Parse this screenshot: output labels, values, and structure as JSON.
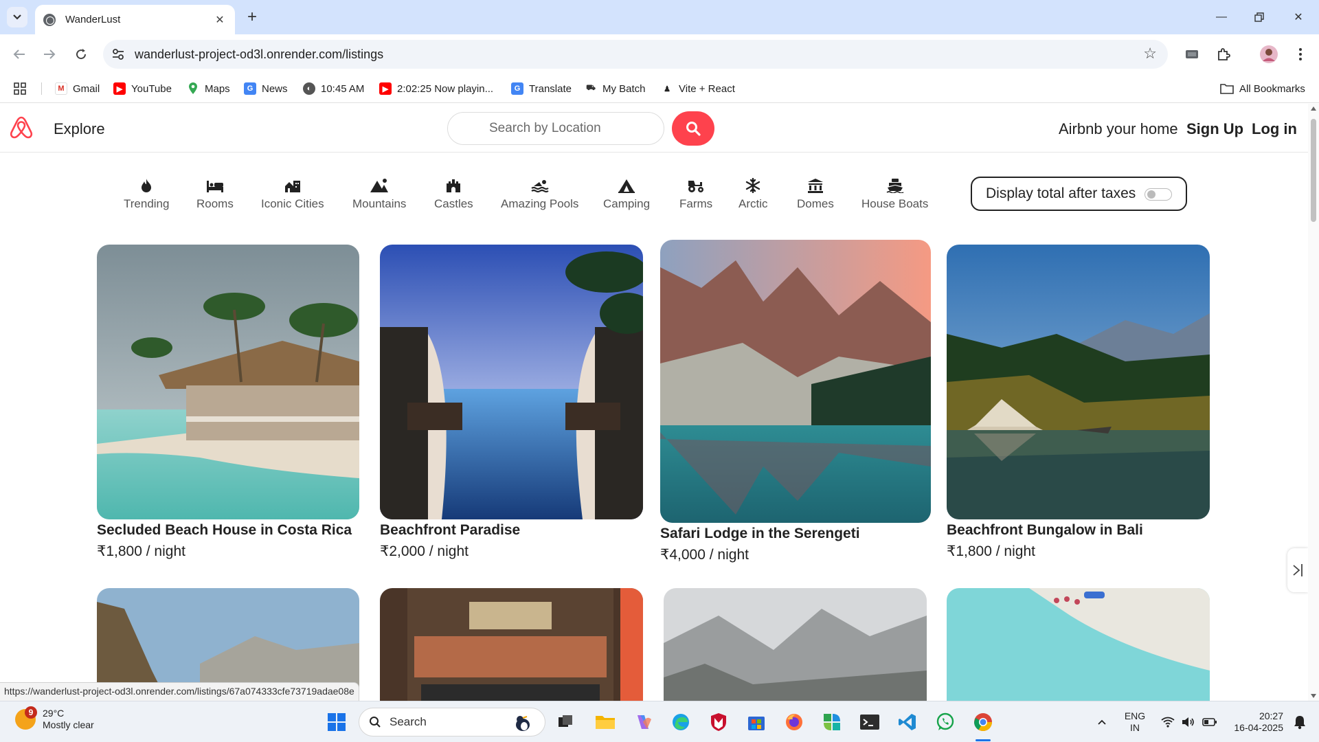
{
  "browser": {
    "tab_title": "WanderLust",
    "url": "wanderlust-project-od3l.onrender.com/listings",
    "status_url": "https://wanderlust-project-od3l.onrender.com/listings/67a074333cfe73719adae08e"
  },
  "bookmarks": {
    "items": [
      {
        "label": "Gmail",
        "icon": "gmail-icon"
      },
      {
        "label": "YouTube",
        "icon": "youtube-icon"
      },
      {
        "label": "Maps",
        "icon": "maps-icon"
      },
      {
        "label": "News",
        "icon": "news-icon"
      },
      {
        "label": "10:45 AM",
        "icon": "globe-icon"
      },
      {
        "label": "2:02:25 Now playin...",
        "icon": "youtube-icon"
      },
      {
        "label": "Translate",
        "icon": "translate-icon"
      },
      {
        "label": "My Batch",
        "icon": "batch-icon"
      },
      {
        "label": "Vite + React",
        "icon": "react-icon"
      }
    ],
    "all_bookmarks": "All Bookmarks"
  },
  "site": {
    "explore": "Explore",
    "search_placeholder": "Search by Location",
    "airbnb_home": "Airbnb your home",
    "sign_up": "Sign Up",
    "log_in": "Log in",
    "brand_color": "#fe424d"
  },
  "filters": [
    {
      "label": "Trending",
      "icon": "fire-icon"
    },
    {
      "label": "Rooms",
      "icon": "bed-icon"
    },
    {
      "label": "Iconic Cities",
      "icon": "city-icon"
    },
    {
      "label": "Mountains",
      "icon": "mountain-icon"
    },
    {
      "label": "Castles",
      "icon": "castle-icon"
    },
    {
      "label": "Amazing Pools",
      "icon": "pool-icon"
    },
    {
      "label": "Camping",
      "icon": "campground-icon"
    },
    {
      "label": "Farms",
      "icon": "tractor-icon"
    },
    {
      "label": "Arctic",
      "icon": "snowflake-icon"
    },
    {
      "label": "Domes",
      "icon": "dome-icon"
    },
    {
      "label": "House Boats",
      "icon": "ship-icon"
    }
  ],
  "tax_toggle": {
    "label": "Display total after taxes",
    "enabled": false
  },
  "listings": [
    {
      "title": "Secluded Beach House in Costa Rica",
      "price": "₹1,800 / night"
    },
    {
      "title": "Beachfront Paradise",
      "price": "₹2,000 / night"
    },
    {
      "title": "Safari Lodge in the Serengeti",
      "price": "₹4,000 / night"
    },
    {
      "title": "Beachfront Bungalow in Bali",
      "price": "₹1,800 / night"
    }
  ],
  "taskbar": {
    "weather_temp": "29°C",
    "weather_desc": "Mostly clear",
    "weather_badge": "9",
    "search_label": "Search",
    "lang_line1": "ENG",
    "lang_line2": "IN",
    "time": "20:27",
    "date": "16-04-2025"
  }
}
